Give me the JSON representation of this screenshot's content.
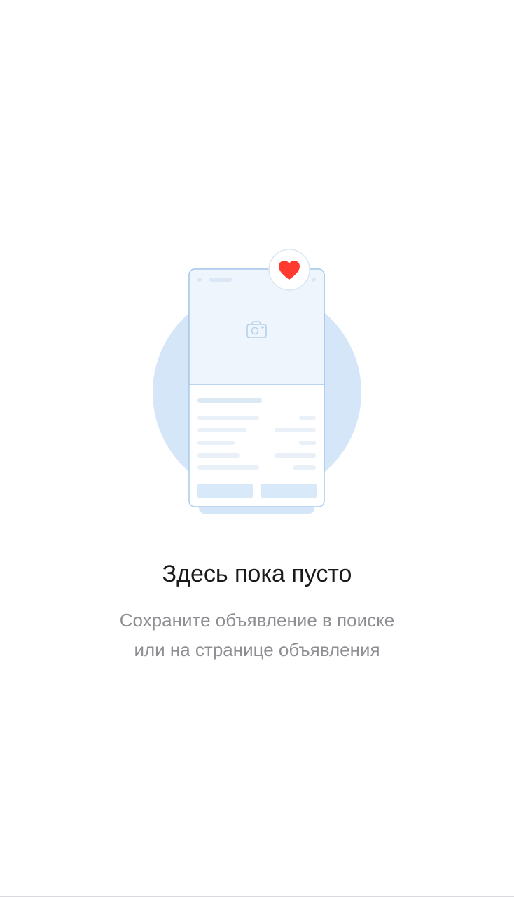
{
  "empty_state": {
    "title": "Здесь пока пусто",
    "subtitle_line_1": "Сохраните объявление в поиске",
    "subtitle_line_2": "или на странице объявления"
  },
  "illustration": {
    "icons": [
      "camera-icon",
      "heart-icon"
    ],
    "colors": {
      "circle": "#d5e6f8",
      "card_outline": "#a9c9ec",
      "card_top_fill": "#eff5fc",
      "placeholder_lines": "#e8eef6",
      "buttons": "#d8eafa",
      "heart": "#ff3b30"
    }
  }
}
